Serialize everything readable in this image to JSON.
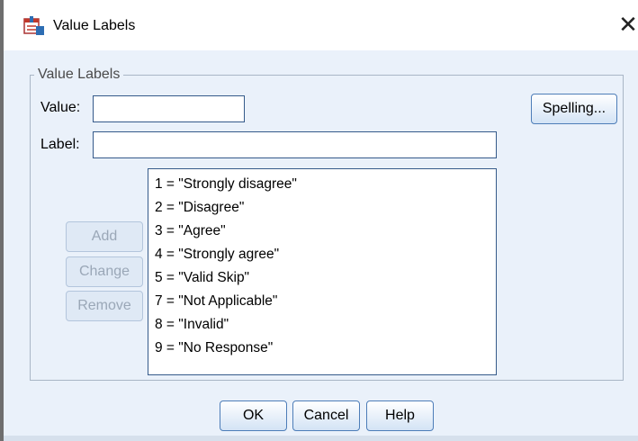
{
  "window": {
    "title": "Value Labels"
  },
  "group": {
    "legend": "Value Labels"
  },
  "fields": {
    "value_label": "Value:",
    "value_text": "",
    "label_label": "Label:",
    "label_text": ""
  },
  "buttons": {
    "spelling": "Spelling...",
    "add": "Add",
    "change": "Change",
    "remove": "Remove",
    "ok": "OK",
    "cancel": "Cancel",
    "help": "Help"
  },
  "value_labels": [
    "1 = \"Strongly disagree\"",
    "2 = \"Disagree\"",
    "3 = \"Agree\"",
    "4 = \"Strongly agree\"",
    "5 = \"Valid Skip\"",
    "7 = \"Not Applicable\"",
    "8 = \"Invalid\"",
    "9 = \"No Response\""
  ],
  "icons": {
    "app": "value-labels-app-icon",
    "close": "close-icon"
  }
}
